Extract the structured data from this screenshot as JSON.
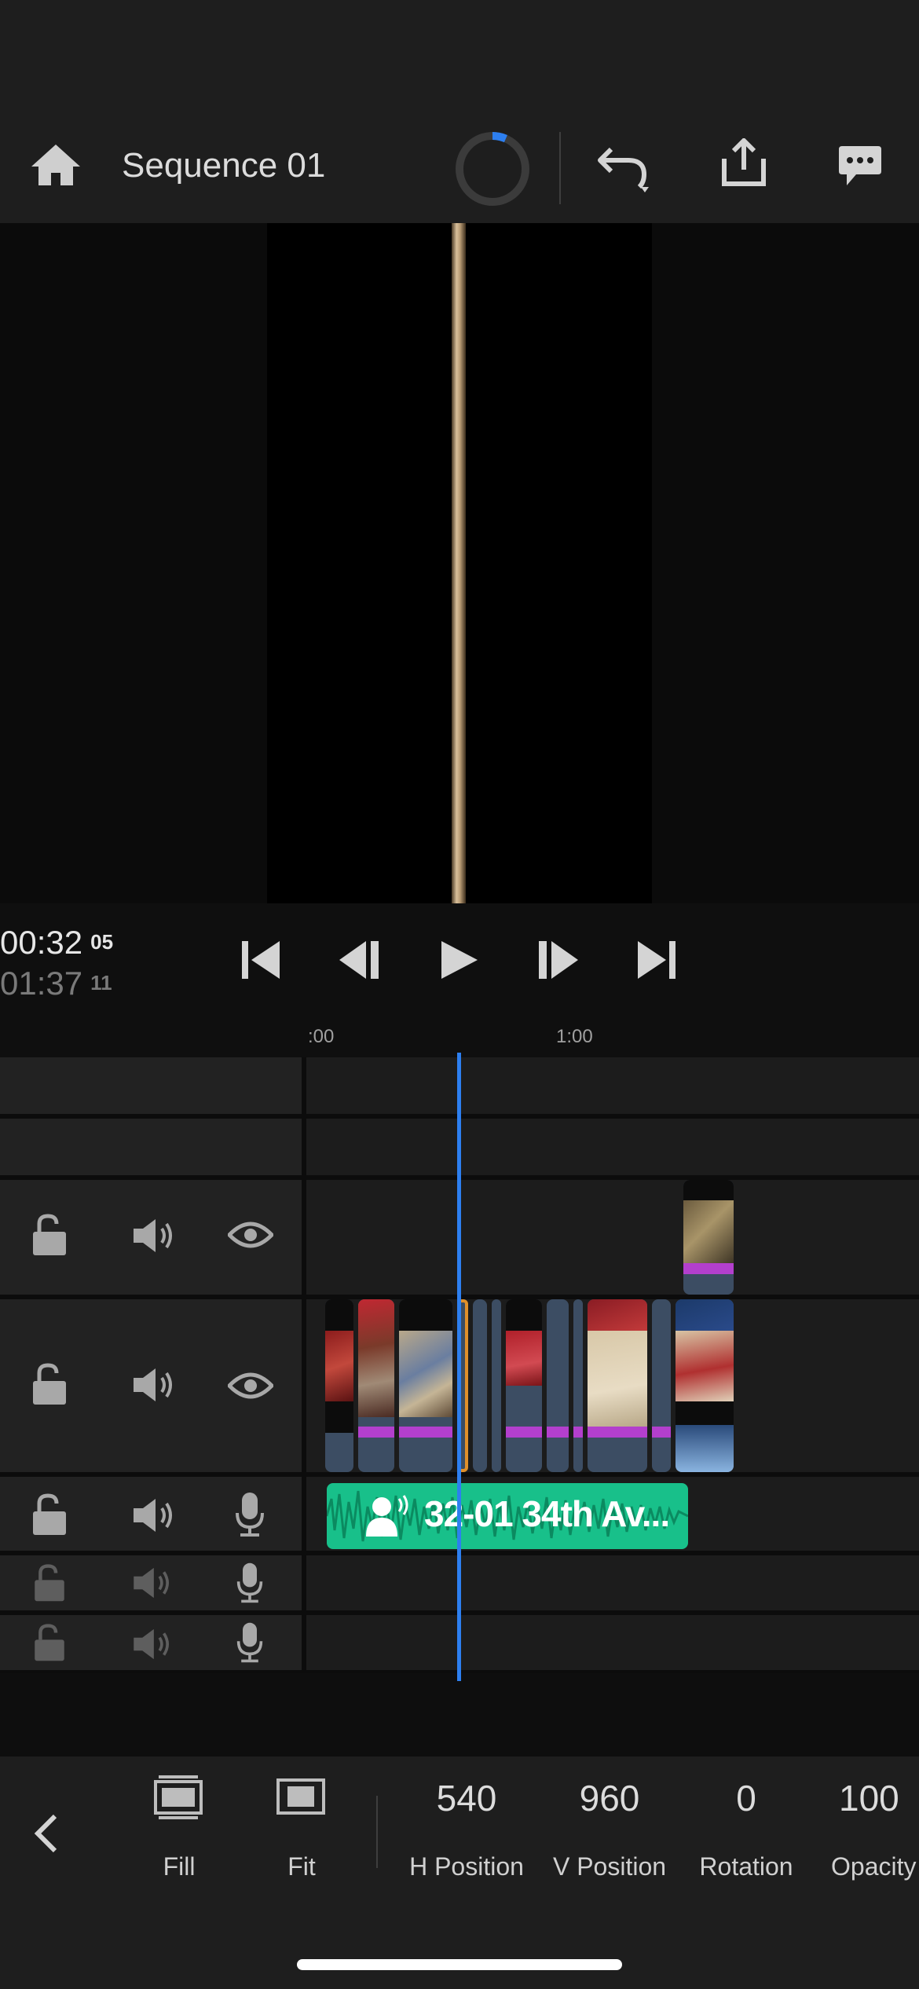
{
  "header": {
    "sequence_title": "Sequence 01",
    "icons": [
      "home-icon",
      "progress-ring-icon",
      "undo-icon",
      "share-icon",
      "comments-icon"
    ]
  },
  "transport": {
    "current_time": "00:32",
    "current_frames": "05",
    "total_time": "01:37",
    "total_frames": "11",
    "ruler_labels": [
      ":00",
      "1:00"
    ],
    "progress_fraction": 0.33
  },
  "timeline": {
    "audio_clip_label": "32-01 34th Av...",
    "colors": {
      "playhead": "#2d7ff0",
      "audio_clip": "#18c08a",
      "clip": "#3c4d63",
      "magenta_bar": "#b33fcd"
    }
  },
  "toolbar": {
    "fill_label": "Fill",
    "fit_label": "Fit",
    "h_position_value": "540",
    "h_position_label": "H Position",
    "v_position_value": "960",
    "v_position_label": "V Position",
    "rotation_value": "0",
    "rotation_label": "Rotation",
    "opacity_value": "100",
    "opacity_label": "Opacity"
  }
}
